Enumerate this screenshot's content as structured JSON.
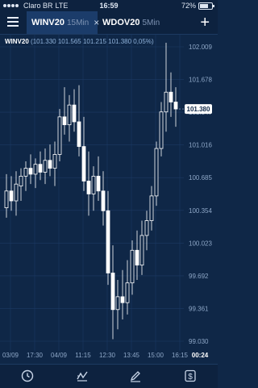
{
  "status": {
    "carrier": "Claro BR",
    "network": "LTE",
    "time": "16:59",
    "battery": "72%",
    "battery_level": 0.72
  },
  "tabs": [
    {
      "symbol": "WINV20",
      "timeframe": "15Min",
      "close": "×",
      "active": true
    },
    {
      "symbol": "WDOV20",
      "timeframe": "5Min",
      "active": false
    }
  ],
  "chart_header": {
    "symbol": "WINV20",
    "ohlc": "(101.330  101.565  101.215  101.380  0,05%)"
  },
  "chart_data": {
    "type": "candlestick",
    "y_ticks": [
      "102.009",
      "101.678",
      "101.347",
      "101.016",
      "100.685",
      "100.354",
      "100.023",
      "99.692",
      "99.361",
      "99.030"
    ],
    "y_range": [
      99.03,
      102.009
    ],
    "x_ticks": [
      "03/09",
      "17:30",
      "04/09",
      "11:15",
      "12:30",
      "13:45",
      "15:00",
      "16:15",
      "00:24"
    ],
    "last_price": "101.380",
    "grid": true,
    "candles": [
      {
        "o": 100.38,
        "h": 100.72,
        "l": 100.28,
        "c": 100.55
      },
      {
        "o": 100.55,
        "h": 100.7,
        "l": 100.35,
        "c": 100.45
      },
      {
        "o": 100.45,
        "h": 100.75,
        "l": 100.3,
        "c": 100.62
      },
      {
        "o": 100.6,
        "h": 100.78,
        "l": 100.45,
        "c": 100.7
      },
      {
        "o": 100.7,
        "h": 100.85,
        "l": 100.55,
        "c": 100.78
      },
      {
        "o": 100.78,
        "h": 100.92,
        "l": 100.62,
        "c": 100.72
      },
      {
        "o": 100.72,
        "h": 100.88,
        "l": 100.58,
        "c": 100.82
      },
      {
        "o": 100.82,
        "h": 100.95,
        "l": 100.66,
        "c": 100.74
      },
      {
        "o": 100.74,
        "h": 100.98,
        "l": 100.62,
        "c": 100.86
      },
      {
        "o": 100.86,
        "h": 101.02,
        "l": 100.7,
        "c": 100.78
      },
      {
        "o": 100.78,
        "h": 101.05,
        "l": 100.6,
        "c": 100.92
      },
      {
        "o": 100.92,
        "h": 101.38,
        "l": 100.85,
        "c": 101.3
      },
      {
        "o": 101.3,
        "h": 101.6,
        "l": 101.12,
        "c": 101.22
      },
      {
        "o": 101.22,
        "h": 101.52,
        "l": 101.05,
        "c": 101.42
      },
      {
        "o": 101.42,
        "h": 101.58,
        "l": 101.15,
        "c": 101.25
      },
      {
        "o": 101.25,
        "h": 101.62,
        "l": 100.9,
        "c": 101.0
      },
      {
        "o": 101.0,
        "h": 101.3,
        "l": 100.55,
        "c": 100.65
      },
      {
        "o": 100.65,
        "h": 100.95,
        "l": 100.3,
        "c": 100.52
      },
      {
        "o": 100.52,
        "h": 100.8,
        "l": 100.35,
        "c": 100.7
      },
      {
        "o": 100.7,
        "h": 100.9,
        "l": 100.45,
        "c": 100.55
      },
      {
        "o": 100.55,
        "h": 100.75,
        "l": 100.2,
        "c": 100.35
      },
      {
        "o": 100.35,
        "h": 100.55,
        "l": 99.6,
        "c": 99.72
      },
      {
        "o": 99.72,
        "h": 100.0,
        "l": 99.05,
        "c": 99.35
      },
      {
        "o": 99.35,
        "h": 99.65,
        "l": 99.15,
        "c": 99.48
      },
      {
        "o": 99.48,
        "h": 99.75,
        "l": 99.25,
        "c": 99.42
      },
      {
        "o": 99.42,
        "h": 99.85,
        "l": 99.3,
        "c": 99.62
      },
      {
        "o": 99.62,
        "h": 100.05,
        "l": 99.5,
        "c": 99.95
      },
      {
        "o": 99.95,
        "h": 100.15,
        "l": 99.65,
        "c": 99.8
      },
      {
        "o": 99.8,
        "h": 100.25,
        "l": 99.7,
        "c": 100.1
      },
      {
        "o": 100.1,
        "h": 100.35,
        "l": 99.95,
        "c": 100.25
      },
      {
        "o": 100.25,
        "h": 100.6,
        "l": 100.15,
        "c": 100.5
      },
      {
        "o": 100.5,
        "h": 101.05,
        "l": 100.4,
        "c": 100.98
      },
      {
        "o": 100.98,
        "h": 101.45,
        "l": 100.9,
        "c": 101.35
      },
      {
        "o": 101.35,
        "h": 102.05,
        "l": 101.15,
        "c": 101.55
      },
      {
        "o": 101.55,
        "h": 101.75,
        "l": 101.3,
        "c": 101.45
      },
      {
        "o": 101.45,
        "h": 101.6,
        "l": 101.2,
        "c": 101.38
      }
    ]
  },
  "toolbar": [
    {
      "name": "clock-icon"
    },
    {
      "name": "indicator-icon"
    },
    {
      "name": "pencil-icon"
    },
    {
      "name": "dollar-icon"
    }
  ],
  "colors": {
    "background": "#0f2747",
    "candle": "#ffffff",
    "grid": "#1c3a63",
    "axis_text": "#8ea7c7"
  }
}
